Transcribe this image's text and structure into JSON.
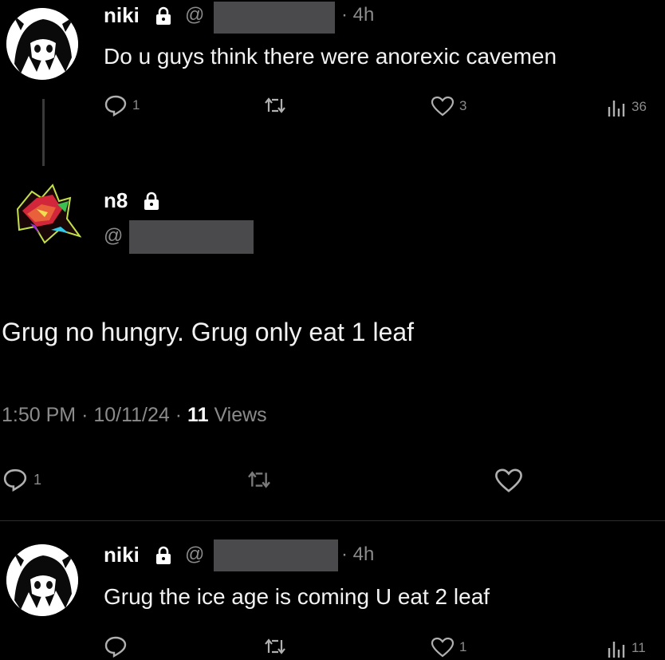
{
  "tweets": [
    {
      "name": "niki",
      "handle_prefix": "@",
      "time": "· 4h",
      "text": "Do u guys think there were anorexic cavemen",
      "actions": {
        "replies": "1",
        "retweets": "",
        "likes": "3",
        "views": "36"
      }
    },
    {
      "name": "n8",
      "handle_prefix": "@",
      "text": "Grug no hungry. Grug only eat 1 leaf",
      "meta": {
        "time": "1:50 PM",
        "sep1": "·",
        "date": "10/11/24",
        "sep2": "·",
        "views_count": "11",
        "views_label": "Views"
      },
      "actions": {
        "replies": "1",
        "retweets": "",
        "likes": ""
      }
    },
    {
      "name": "niki",
      "handle_prefix": "@",
      "time": "· 4h",
      "text": "Grug the ice age is coming U eat 2 leaf",
      "actions": {
        "replies": "",
        "retweets": "",
        "likes": "1",
        "views": "11"
      }
    }
  ],
  "colors": {
    "background": "#000000",
    "muted": "#8b8b8b",
    "redaction": "#4a4a4c"
  },
  "icons": [
    "lock-icon",
    "reply-icon",
    "retweet-icon",
    "like-icon",
    "views-icon"
  ]
}
